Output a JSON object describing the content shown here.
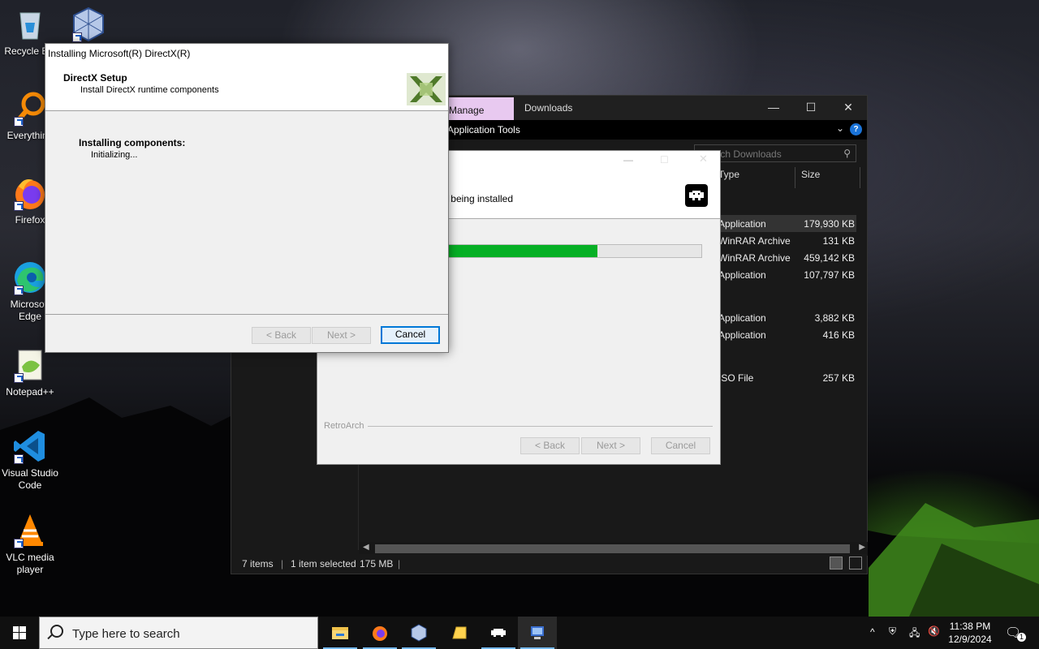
{
  "desktop": {
    "icons": [
      {
        "label": "Recycle Bin"
      },
      {
        "label": "Oracle VM VirtualBox"
      },
      {
        "label": "Everything"
      },
      {
        "label": "Firefox"
      },
      {
        "label": "Microsoft Edge"
      },
      {
        "label": "Notepad++"
      },
      {
        "label": "Visual Studio Code"
      },
      {
        "label": "VLC media player"
      }
    ]
  },
  "explorer": {
    "manage_tab": "Manage",
    "title": "Downloads",
    "ribbon_context": "Application Tools",
    "search_placeholder": "Search Downloads",
    "columns": {
      "type": "Type",
      "size": "Size"
    },
    "files": [
      {
        "type": "Application",
        "size": "179,930 KB"
      },
      {
        "type": "WinRAR Archive",
        "size": "131 KB"
      },
      {
        "type": "WinRAR Archive",
        "size": "459,142 KB"
      },
      {
        "type": "Application",
        "size": "107,797 KB"
      },
      {
        "type": "Application",
        "size": "3,882 KB"
      },
      {
        "type": "Application",
        "size": "416 KB"
      },
      {
        "type": "ISO File",
        "size": "257 KB"
      }
    ],
    "status": {
      "items": "7 items",
      "selected": "1 item selected",
      "selected_size": "175 MB"
    }
  },
  "retroarch": {
    "message": "Please wait while RetroArch is being installed.",
    "progress": 0.72,
    "brand": "RetroArch",
    "buttons": {
      "back": "< Back",
      "next": "Next >",
      "cancel": "Cancel"
    }
  },
  "directx": {
    "window_title": "Installing Microsoft(R) DirectX(R)",
    "header_title": "DirectX Setup",
    "header_subtitle": "Install DirectX runtime components",
    "status_title": "Installing components:",
    "status_detail": "Initializing...",
    "buttons": {
      "back": "< Back",
      "next": "Next >",
      "cancel": "Cancel"
    }
  },
  "taskbar": {
    "search_placeholder": "Type here to search",
    "time": "11:38 PM",
    "date": "12/9/2024",
    "notification_count": "1",
    "accent": "#76b9ed"
  }
}
